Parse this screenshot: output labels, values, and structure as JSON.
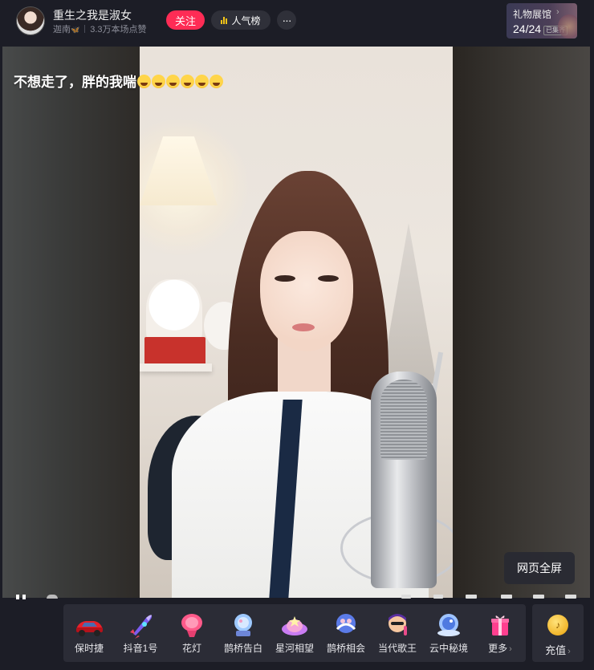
{
  "header": {
    "streamer_name": "重生之我是淑女",
    "streamer_sub_name": "迦南",
    "likes_text": "3.3万本场点赞",
    "follow_label": "关注",
    "ranking_label": "人气榜",
    "more_label": "···",
    "gift_gallery": {
      "title": "礼物展馆",
      "arrow": "›",
      "count": "24/24",
      "badge": "已集齐"
    }
  },
  "video": {
    "overlay_text": "不想走了，胖的我喘",
    "emoji_count": 6,
    "fullscreen_label": "网页全屏"
  },
  "gifts": [
    {
      "label": "保时捷",
      "icon": "sports-car-icon"
    },
    {
      "label": "抖音1号",
      "icon": "rocket-icon"
    },
    {
      "label": "花灯",
      "icon": "flower-lantern-icon"
    },
    {
      "label": "鹊桥告白",
      "icon": "crystal-ball-icon"
    },
    {
      "label": "星河相望",
      "icon": "starry-river-icon"
    },
    {
      "label": "鹊桥相会",
      "icon": "magpie-bridge-icon"
    },
    {
      "label": "当代歌王",
      "icon": "singer-icon"
    },
    {
      "label": "云中秘境",
      "icon": "cloud-realm-icon"
    },
    {
      "label": "更多",
      "icon": "gift-box-icon"
    }
  ],
  "recharge": {
    "label": "充值",
    "icon": "coin-icon"
  },
  "colors": {
    "background": "#1c1d26",
    "follow_button": "#fe2c55",
    "panel": "#2b2c36",
    "rank_button": "#2f3039"
  }
}
